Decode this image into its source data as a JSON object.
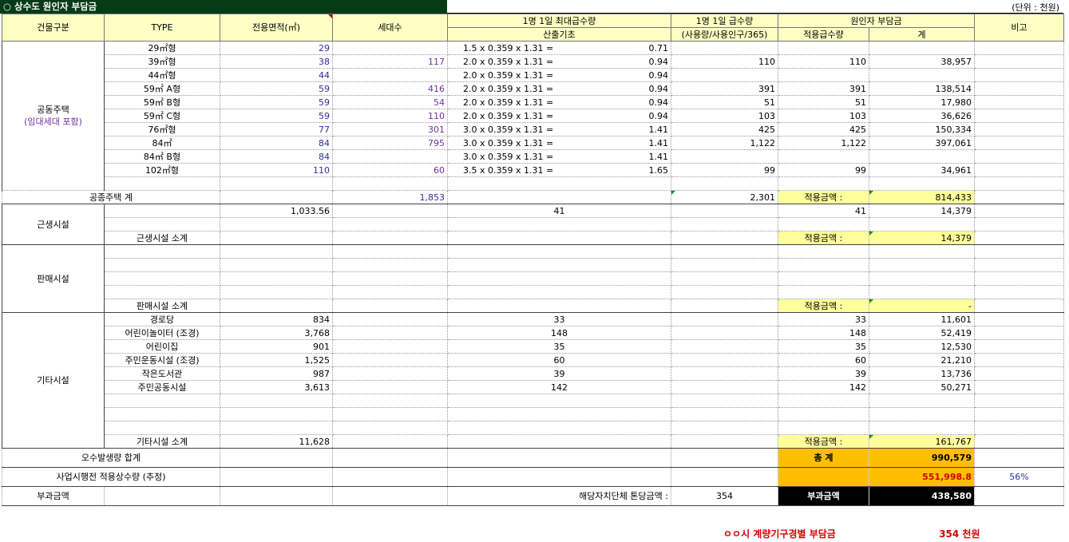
{
  "title": "○ 상수도 원인자 부담금",
  "unit": "(단위 : 천원)",
  "headers": {
    "building_type": "건물구분",
    "type": "TYPE",
    "area": "전용면적(㎥)",
    "households": "세대수",
    "max_supply": "1명 1일 최대급수량",
    "calc_basis": "산출기초",
    "daily_supply": "1명 1일 급수량",
    "usage_ratio": "(사용량/사용인구/365)",
    "charge": "원인자 부담금",
    "applied_supply": "적용급수량",
    "total": "계",
    "note": "비고"
  },
  "apartment": {
    "group": "공동주택",
    "group_sub": "(임대세대 포함)",
    "rows": [
      {
        "type": "29㎡형",
        "area": "29",
        "households": "",
        "calc": "1.5 x 0.359 x 1.31 =",
        "calc_val": "0.71",
        "usage": "",
        "applied": "",
        "total": ""
      },
      {
        "type": "39㎡형",
        "area": "38",
        "households": "117",
        "calc": "2.0 x 0.359 x 1.31 =",
        "calc_val": "0.94",
        "usage": "110",
        "applied": "110",
        "total": "38,957"
      },
      {
        "type": "44㎡형",
        "area": "44",
        "households": "",
        "calc": "2.0 x 0.359 x 1.31 =",
        "calc_val": "0.94",
        "usage": "",
        "applied": "",
        "total": ""
      },
      {
        "type": "59㎡ A형",
        "area": "59",
        "households": "416",
        "calc": "2.0 x 0.359 x 1.31 =",
        "calc_val": "0.94",
        "usage": "391",
        "applied": "391",
        "total": "138,514"
      },
      {
        "type": "59㎡ B형",
        "area": "59",
        "households": "54",
        "calc": "2.0 x 0.359 x 1.31 =",
        "calc_val": "0.94",
        "usage": "51",
        "applied": "51",
        "total": "17,980"
      },
      {
        "type": "59㎡ C형",
        "area": "59",
        "households": "110",
        "calc": "2.0 x 0.359 x 1.31 =",
        "calc_val": "0.94",
        "usage": "103",
        "applied": "103",
        "total": "36,626"
      },
      {
        "type": "76㎡형",
        "area": "77",
        "households": "301",
        "calc": "3.0 x 0.359 x 1.31 =",
        "calc_val": "1.41",
        "usage": "425",
        "applied": "425",
        "total": "150,334"
      },
      {
        "type": "84㎡",
        "area": "84",
        "households": "795",
        "calc": "3.0 x 0.359 x 1.31 =",
        "calc_val": "1.41",
        "usage": "1,122",
        "applied": "1,122",
        "total": "397,061"
      },
      {
        "type": "84㎡ B형",
        "area": "84",
        "households": "",
        "calc": "3.0 x 0.359 x 1.31 =",
        "calc_val": "1.41",
        "usage": "",
        "applied": "",
        "total": ""
      },
      {
        "type": "102㎡형",
        "area": "110",
        "households": "60",
        "calc": "3.5 x 0.359 x 1.31 =",
        "calc_val": "1.65",
        "usage": "99",
        "applied": "99",
        "total": "34,961"
      }
    ],
    "subtotal_label": "공종주택 계",
    "subtotal_households": "1,853",
    "subtotal_usage": "2,301",
    "applied_label": "적용금액 :",
    "subtotal_total": "814,433"
  },
  "neighborhood": {
    "group": "근생시설",
    "area": "1,033.56",
    "calc": "41",
    "applied": "41",
    "total": "14,379",
    "subtotal_label": "근생시설 소계",
    "applied_label": "적용금액 :",
    "subtotal_total": "14,379"
  },
  "sales": {
    "group": "판매시설",
    "subtotal_label": "판매시설 소계",
    "applied_label": "적용금액 :",
    "subtotal_total": "-"
  },
  "other": {
    "group": "기타시설",
    "rows": [
      {
        "type": "경로당",
        "area": "834",
        "calc": "33",
        "applied": "33",
        "total": "11,601"
      },
      {
        "type": "어린이놀이터 (조경)",
        "area": "3,768",
        "calc": "148",
        "applied": "148",
        "total": "52,419"
      },
      {
        "type": "어린이집",
        "area": "901",
        "calc": "35",
        "applied": "35",
        "total": "12,530"
      },
      {
        "type": "주민운동시설 (조경)",
        "area": "1,525",
        "calc": "60",
        "applied": "60",
        "total": "21,210"
      },
      {
        "type": "작은도서관",
        "area": "987",
        "calc": "39",
        "applied": "39",
        "total": "13,736"
      },
      {
        "type": "주민공동시설",
        "area": "3,613",
        "calc": "142",
        "applied": "142",
        "total": "50,271"
      }
    ],
    "subtotal_label": "기타시설 소계",
    "subtotal_area": "11,628",
    "applied_label": "적용금액 :",
    "subtotal_total": "161,767"
  },
  "summary": {
    "sewage_label": "오수발생량 합계",
    "total_label": "총 계",
    "total_value": "990,579",
    "pre_label": "사업시행전 적용상수량 (추정)",
    "pre_value": "551,998.8",
    "pre_pct": "56%",
    "levy_label": "부과금액",
    "local_label": "해당자치단체 톤당금액 :",
    "local_value": "354",
    "levy_box_label": "부과금액",
    "levy_value": "438,580"
  },
  "footer": {
    "label": "ㅇㅇ시 계량기구경별 부담금",
    "value": "354 천원"
  },
  "colors": {
    "title_bg": "#063b17",
    "header_bg": "#ffffc4",
    "highlight_yellow": "#ffff9c",
    "highlight_orange": "#ffbf00",
    "levy_bg": "#000000",
    "red_text": "#d40000",
    "blue_text": "#2f2f9c"
  }
}
